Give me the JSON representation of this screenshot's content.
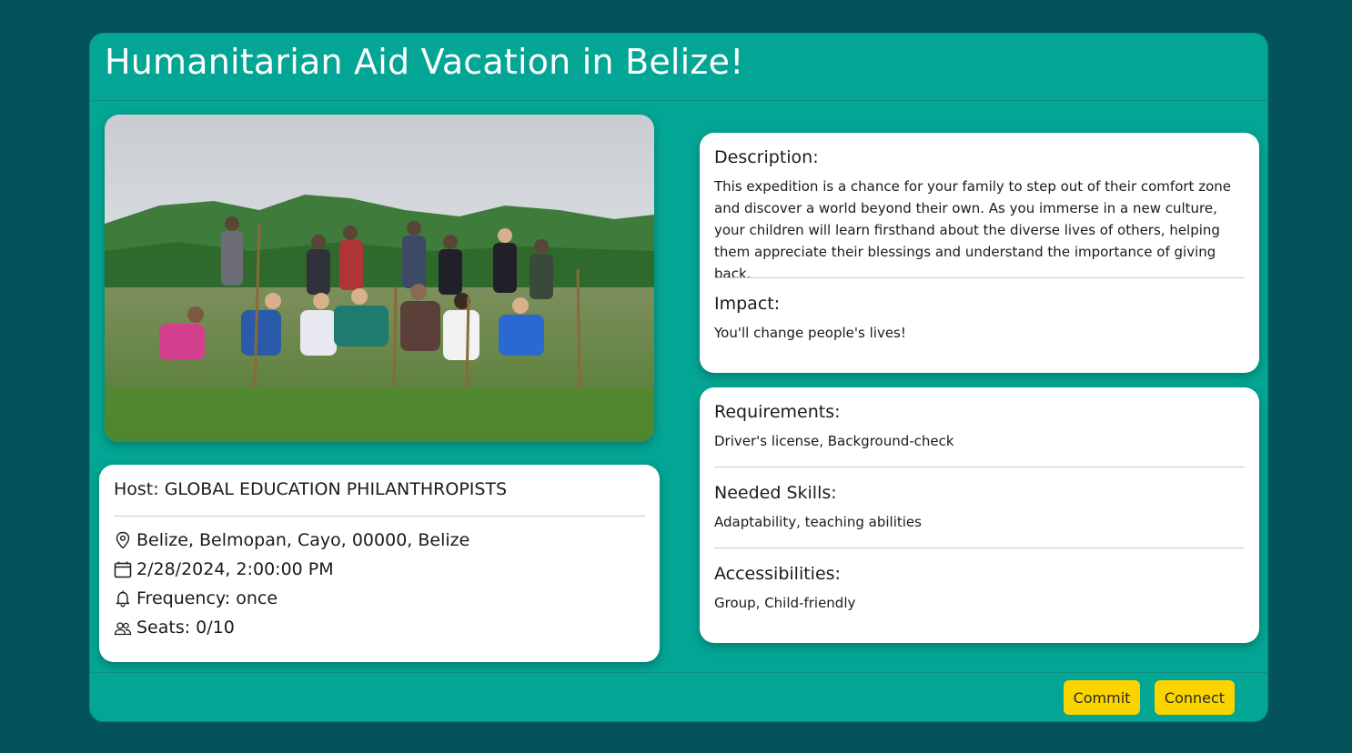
{
  "title": "Humanitarian Aid Vacation in Belize!",
  "host": {
    "label": "Host: GLOBAL EDUCATION PHILANTHROPISTS",
    "location": "Belize, Belmopan, Cayo, 00000, Belize",
    "date": "2/28/2024, 2:00:00 PM",
    "frequency": "Frequency: once",
    "seats": "Seats: 0/10"
  },
  "description": {
    "title": "Description:",
    "body": "This expedition is a chance for your family to step out of their comfort zone and discover a world beyond their own. As you immerse in a new culture, your children will learn firsthand about the diverse lives of others, helping them appreciate their blessings and understand the importance of giving back."
  },
  "impact": {
    "title": "Impact:",
    "body": "You'll change people's lives!"
  },
  "requirements": {
    "title": "Requirements:",
    "body": "Driver's license, Background-check"
  },
  "skills": {
    "title": "Needed Skills:",
    "body": "Adaptability, teaching abilities"
  },
  "accessibilities": {
    "title": "Accessibilities:",
    "body": "Group, Child-friendly"
  },
  "footer": {
    "commit_label": "Commit",
    "connect_label": "Connect"
  },
  "icons": {
    "location": "map-pin-icon",
    "date": "calendar-icon",
    "frequency": "bell-icon",
    "seats": "people-icon"
  },
  "colors": {
    "page_bg": "#02545a",
    "modal_bg": "#03a594",
    "button": "#fbd400"
  }
}
